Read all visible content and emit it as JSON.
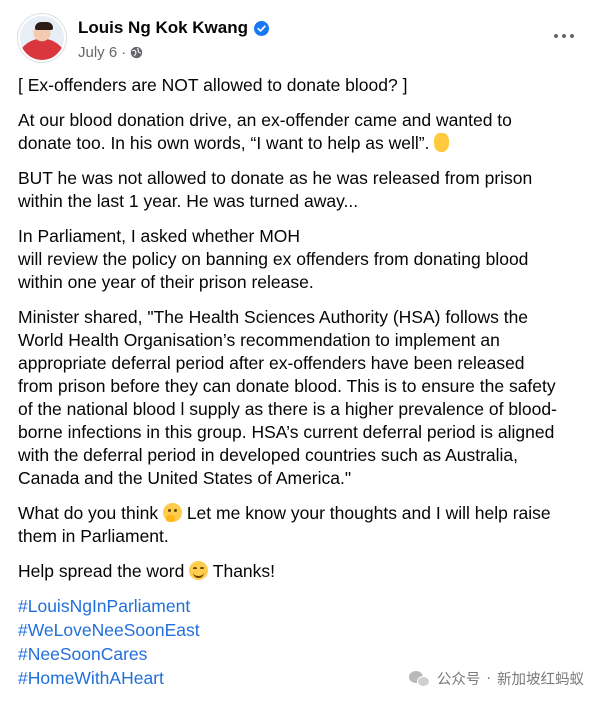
{
  "post": {
    "author": "Louis Ng Kok Kwang",
    "date": "July 6",
    "separator": "·",
    "verified_icon": "verified-badge-icon",
    "audience_icon": "globe-icon",
    "more_icon": "more-options-icon"
  },
  "body": {
    "p1": {
      "l1": "[ Ex-offenders are NOT allowed to donate blood? ]"
    },
    "p2": {
      "l1": "At our blood donation drive, an ex-offender came and wanted to",
      "l2": "donate too. In his own words, “I want to help as well”.",
      "emoji": "hand-emoji"
    },
    "p3": {
      "l1": "BUT he was not allowed to donate as he was released from prison",
      "l2": "within the last 1 year. He was turned away..."
    },
    "p4": {
      "l1": "In Parliament, I asked whether MOH",
      "l2": "will review the policy on banning ex offenders from donating blood",
      "l3": "within one year of their prison release."
    },
    "p5": {
      "l1": "Minister shared, \"The Health Sciences Authority (HSA) follows the",
      "l2": "World Health Organisation’s recommendation to implement an",
      "l3": "appropriate deferral period after ex-offenders have been released",
      "l4": "from prison before they can donate blood. This is to ensure the safety",
      "l5": "of the national blood l supply as there is a higher prevalence of blood-",
      "l6": "borne infections in this group. HSA’s current deferral period is aligned",
      "l7": "with the deferral period in developed countries such as Australia,",
      "l8": "Canada and the United States of America.\""
    },
    "p6": {
      "l1a": "What do you think",
      "l1b": "Let me know your thoughts and I will help raise",
      "l2": "them in Parliament.",
      "emoji": "thinking-face-emoji"
    },
    "p7": {
      "a": "Help spread the word",
      "b": "Thanks!",
      "emoji": "smiling-face-emoji"
    }
  },
  "hashtags": [
    "#LouisNgInParliament",
    "#WeLoveNeeSoonEast",
    "#NeeSoonCares",
    "#HomeWithAHeart"
  ],
  "watermark": {
    "left": "公众号",
    "sep": "·",
    "right": "新加坡红蚂蚁"
  },
  "colors": {
    "link": "#216fdb",
    "meta": "#65676b",
    "verified": "#1877f2"
  }
}
